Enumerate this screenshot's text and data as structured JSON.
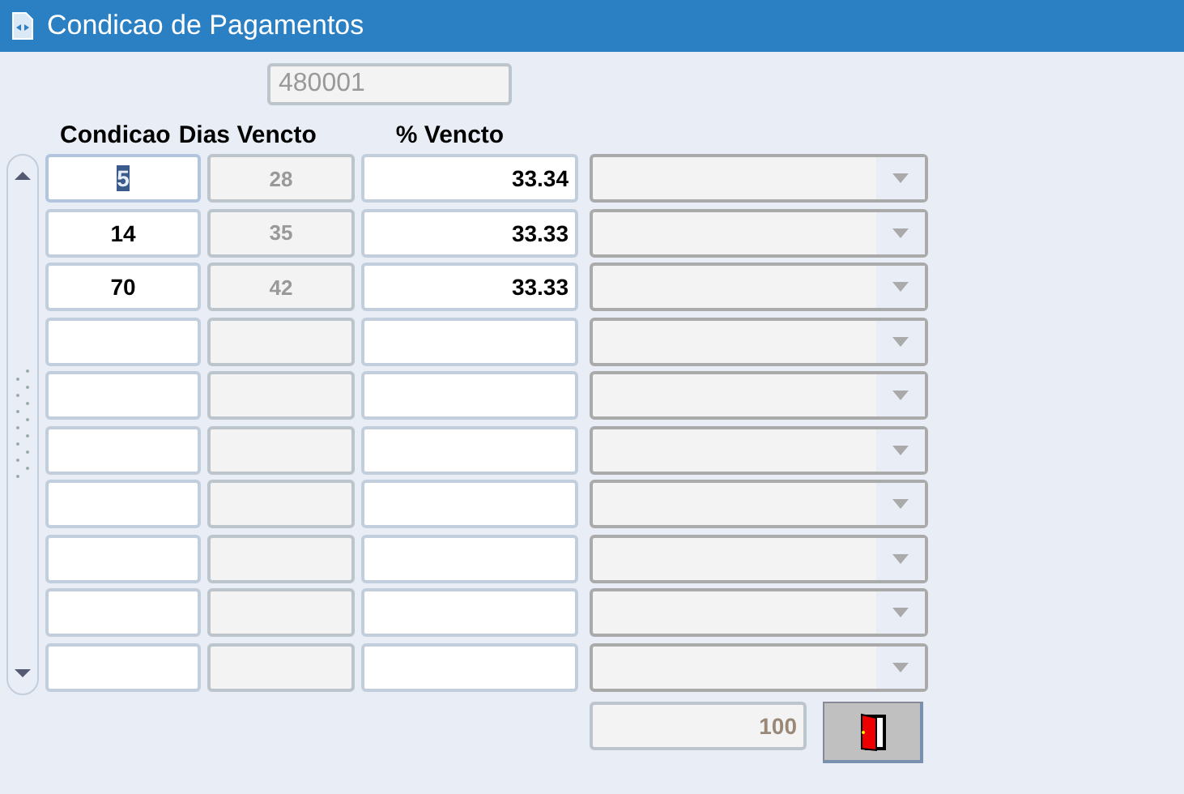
{
  "window": {
    "title": "Condicao de Pagamentos"
  },
  "code_field": {
    "value": "480001"
  },
  "columns": [
    "Condicao",
    "Dias Vencto",
    "% Vencto"
  ],
  "rows": [
    {
      "condicao": "5",
      "dias": "28",
      "percent": "33.34",
      "selected": true
    },
    {
      "condicao": "14",
      "dias": "35",
      "percent": "33.33",
      "selected": false
    },
    {
      "condicao": "70",
      "dias": "42",
      "percent": "33.33",
      "selected": false
    },
    {
      "selected": false
    },
    {
      "selected": false
    },
    {
      "selected": false
    },
    {
      "selected": false
    },
    {
      "selected": false
    },
    {
      "selected": false
    },
    {
      "selected": false
    }
  ],
  "total": {
    "value": "100"
  }
}
